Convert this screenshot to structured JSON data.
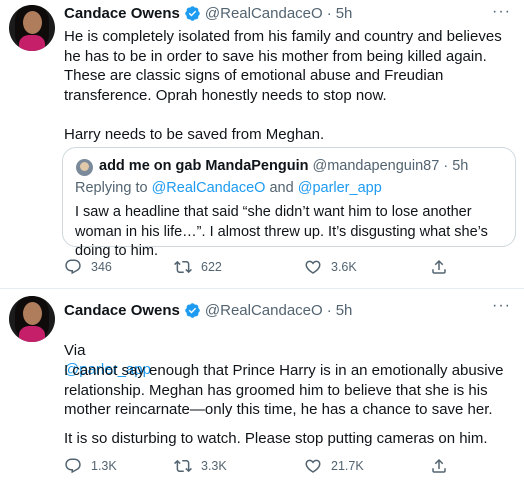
{
  "tweets": [
    {
      "author_name": "Candace Owens",
      "author_handle": "@RealCandaceO",
      "time": "5h",
      "lines": [
        "He is completely isolated from his family and country and believes he has to be in order to save his mother from being killed again.",
        "These are classic signs of emotional abuse and Freudian transference. Oprah honestly needs to stop now.",
        "",
        "Harry needs to be saved from Meghan."
      ],
      "quote": {
        "author_name": "add me on gab MandaPenguin",
        "author_handle": "@mandapenguin87",
        "time": "5h",
        "replying_prefix": "Replying to",
        "replying_to_1": "@RealCandaceO",
        "replying_and": "and",
        "replying_to_2": "@parler_app",
        "text": "I saw a headline that said “she didn’t want him to lose another woman in his life…”. I almost threw up. It’s disgusting what she’s doing to him."
      },
      "replies": "346",
      "retweets": "622",
      "likes": "3.6K"
    },
    {
      "author_name": "Candace Owens",
      "author_handle": "@RealCandaceO",
      "time": "5h",
      "via_prefix": "Via",
      "via_link": "@parler_app",
      "paragraph_1": "I cannot say enough that Prince Harry is in an emotionally abusive relationship. Meghan has groomed him to believe that she is his mother reincarnate—only this time, he has a chance to save her.",
      "paragraph_2": "It is so disturbing to watch. Please stop putting cameras on him.",
      "replies": "1.3K",
      "retweets": "3.3K",
      "likes": "21.7K"
    }
  ],
  "icons": {
    "verified": "verified-badge-icon",
    "more": "more-options-icon",
    "reply": "reply-icon",
    "retweet": "retweet-icon",
    "like": "like-icon",
    "share": "share-icon"
  },
  "colors": {
    "accent": "#1d9bf0",
    "secondary_text": "#536471",
    "primary_text": "#0f1419",
    "border": "#cfd9de"
  }
}
